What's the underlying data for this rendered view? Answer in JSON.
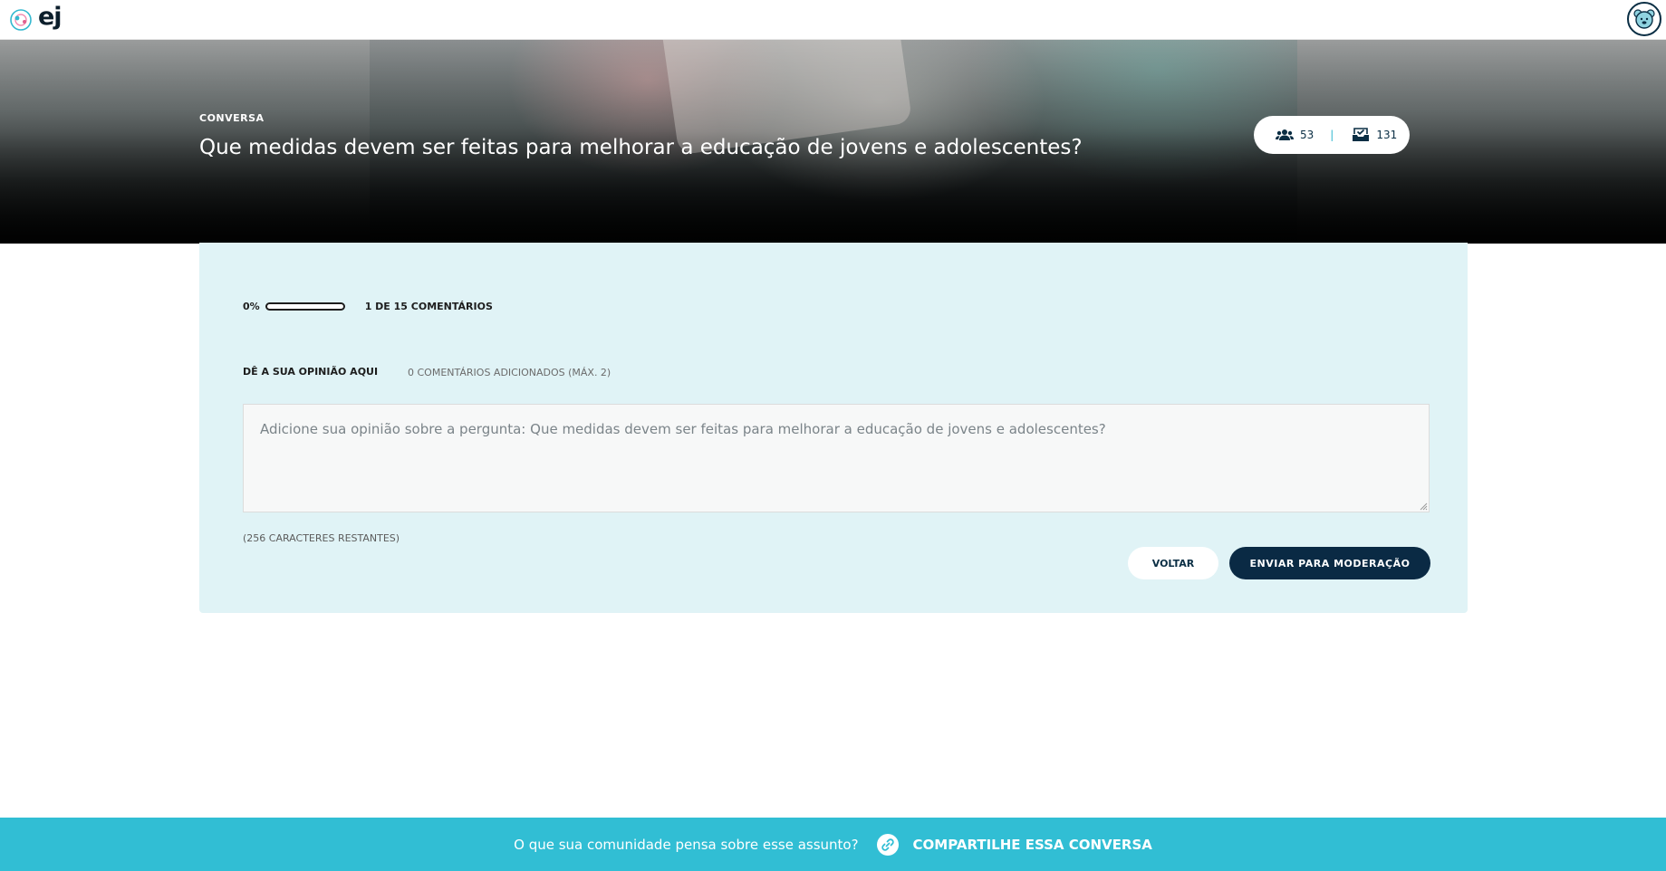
{
  "topbar": {
    "logo_text": "ej",
    "logo_icon": "ej-logo-icon",
    "avatar_icon": "bear-avatar-icon"
  },
  "hero": {
    "label": "CONVERSA",
    "title": "Que medidas devem ser feitas para melhorar a educação de jovens e adolescentes?",
    "stats": {
      "participants_icon": "users-icon",
      "participants": "53",
      "separator": "|",
      "votes_icon": "inbox-check-icon",
      "votes": "131"
    }
  },
  "card": {
    "progress_percent_text": "0%",
    "progress_fraction": 0,
    "comments_progress": "1 DE 15 COMENTÁRIOS",
    "opinion_label": "DÊ A SUA OPINIÃO AQUI",
    "comments_added": "0 COMENTÁRIOS ADICIONADOS (MÁX. 2)",
    "textarea_placeholder": "Adicione sua opinião sobre a pergunta: Que medidas devem ser feitas para melhorar a educação de jovens e adolescentes?",
    "chars_left": "(256 CARACTERES RESTANTES)",
    "back_label": "VOLTAR",
    "send_label": "ENVIAR PARA MODERAÇÃO"
  },
  "footer": {
    "prompt": "O que sua comunidade pensa sobre esse assunto?",
    "share_icon": "link-icon",
    "share_label": "COMPARTILHE ESSA CONVERSA"
  },
  "colors": {
    "accent": "#31bed4",
    "navy": "#0a2a44",
    "card_bg": "#e0f3f6"
  }
}
